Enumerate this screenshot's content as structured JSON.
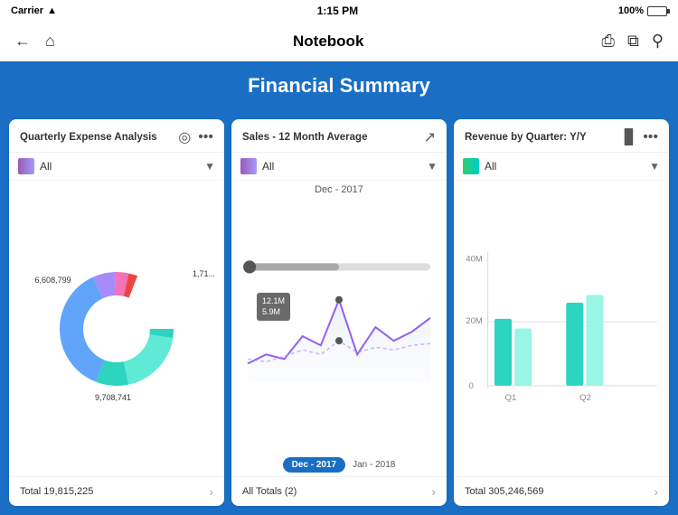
{
  "statusBar": {
    "carrier": "Carrier",
    "wifi": "📶",
    "time": "1:15 PM",
    "battery": "100%"
  },
  "navBar": {
    "title": "Notebook",
    "backIcon": "←",
    "homeIcon": "⌂",
    "shareIcon": "⬆",
    "copyIcon": "⧉",
    "searchIcon": "⌕"
  },
  "pageHeader": {
    "title": "Financial Summary"
  },
  "cards": {
    "expense": {
      "title": "Quarterly Expense Analysis",
      "filterLabel": "All",
      "total": "Total 19,815,225",
      "values": {
        "top": "6,608,799",
        "right": "1,71...",
        "bottom": "9,708,741"
      }
    },
    "sales": {
      "title": "Sales - 12 Month Average",
      "filterLabel": "All",
      "dateLabel": "Dec - 2017",
      "tooltip1": "12.1M",
      "tooltip2": "5.9M",
      "pill1": "Dec - 2017",
      "pill2": "Jan - 2018",
      "total": "All Totals (2)"
    },
    "revenue": {
      "title": "Revenue by Quarter: Y/Y",
      "filterLabel": "All",
      "yAxis": [
        "40M",
        "20M",
        "0"
      ],
      "xAxis": [
        "Q1",
        "Q2"
      ],
      "total": "Total 305,246,569"
    }
  }
}
